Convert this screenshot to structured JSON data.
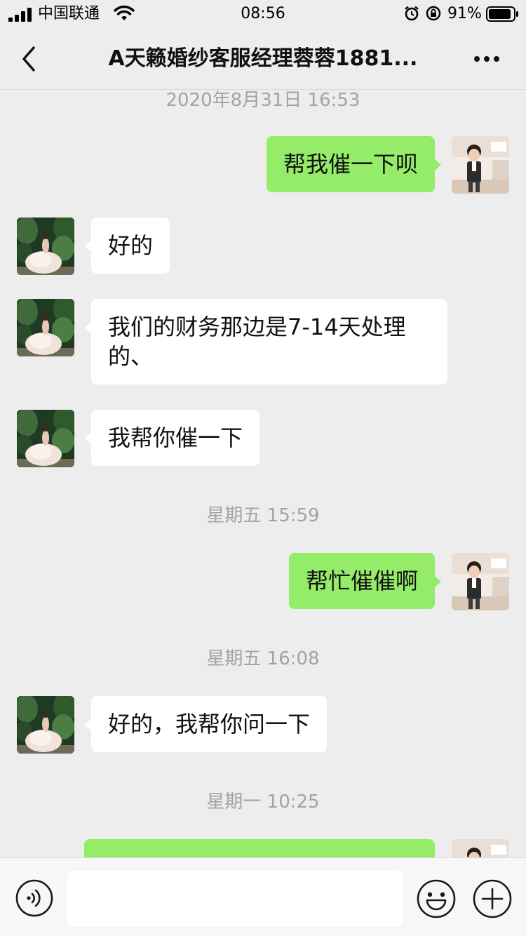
{
  "status_bar": {
    "carrier": "中国联通",
    "time": "08:56",
    "battery_percent": "91%",
    "battery_level": 0.91
  },
  "nav": {
    "title": "A天籁婚纱客服经理蓉蓉1881...",
    "back_icon": "chevron-left-icon",
    "more_icon": "more-horizontal-icon"
  },
  "chat": {
    "timestamps": [
      "2020年8月31日 16:53",
      "星期五 15:59",
      "星期五 16:08",
      "星期一 10:25"
    ],
    "messages": [
      {
        "from": "me",
        "text": "帮我催一下呗"
      },
      {
        "from": "other",
        "text": "好的"
      },
      {
        "from": "other",
        "text": "我们的财务那边是7-14天处理的、"
      },
      {
        "from": "other",
        "text": "我帮你催一下"
      },
      {
        "from": "me",
        "text": "帮忙催催啊"
      },
      {
        "from": "other",
        "text": "好的，我帮你问一下"
      },
      {
        "from": "me",
        "text": ""
      }
    ]
  },
  "input_bar": {
    "voice_icon": "voice-icon",
    "emoji_icon": "emoji-icon",
    "plus_icon": "plus-circle-icon",
    "placeholder": ""
  },
  "colors": {
    "background": "#ededed",
    "outgoing_bubble": "#95ec69",
    "incoming_bubble": "#ffffff",
    "timestamp_text": "#a3a3a3"
  }
}
